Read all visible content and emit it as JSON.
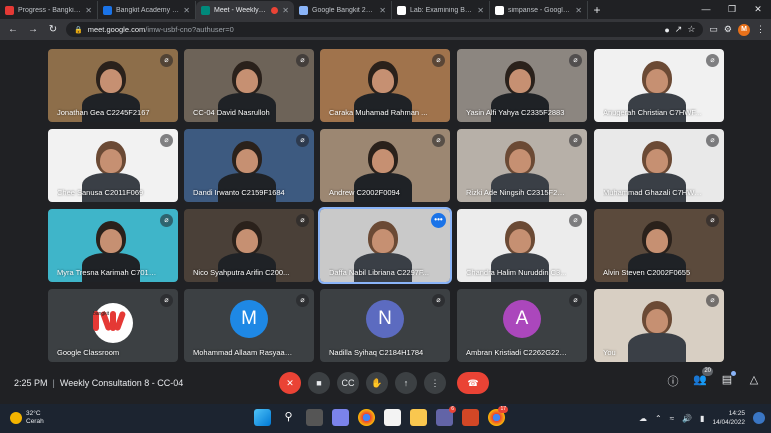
{
  "browser": {
    "tabs": [
      {
        "title": "Progress - Bangkit Stu",
        "favicon_color": "#e53935",
        "active": false
      },
      {
        "title": "Bangkit Academy - Cu",
        "favicon_color": "#1a73e8",
        "active": false
      },
      {
        "title": "Meet - Weekly Co",
        "favicon_color": "#00897b",
        "active": true,
        "recording": true
      },
      {
        "title": "Google Bangkit 2022",
        "favicon_color": "#8ab4f8",
        "active": false
      },
      {
        "title": "Lab: Examining Billing",
        "favicon_color": "#ffffff",
        "active": false
      },
      {
        "title": "simpanse - Google Se",
        "favicon_color": "#ffffff",
        "active": false
      }
    ],
    "new_tab": "+",
    "window_controls": [
      "—",
      "❒",
      "✕"
    ],
    "url_host": "meet.google.com",
    "url_rest": "/imw-usbf-cno?authuser=0",
    "profile_initial": "M"
  },
  "meet": {
    "participants": [
      {
        "name": "Jonathan Gea C2245F2167",
        "bg": "#8d6e4a",
        "type": "video",
        "muted": true
      },
      {
        "name": "CC-04 David Nasrulloh",
        "bg": "#6d6358",
        "type": "video",
        "muted": true
      },
      {
        "name": "Caraka Muhamad Rahman ...",
        "bg": "#a0734c",
        "type": "video",
        "muted": true
      },
      {
        "name": "Yasin Alfi Yahya C2335F2883",
        "bg": "#8c8680",
        "type": "video",
        "muted": true
      },
      {
        "name": "Anugerah Christian C7HWF...",
        "bg": "#f1f1f1",
        "type": "video",
        "muted": true
      },
      {
        "name": "Chee Sanusa C2011F069",
        "bg": "#f2f2f2",
        "type": "video",
        "muted": true
      },
      {
        "name": "Dandi Irwanto C2159F1684",
        "bg": "#3d5a80",
        "type": "video",
        "muted": true
      },
      {
        "name": "Andrew C2002F0094",
        "bg": "#9c8772",
        "type": "video",
        "muted": true
      },
      {
        "name": "Rizki Ade Ningsih C2315F2745",
        "bg": "#b7b0a8",
        "type": "video",
        "muted": true
      },
      {
        "name": "Muhammad Ghazali C7HWF...",
        "bg": "#e9e9e9",
        "type": "video",
        "muted": true
      },
      {
        "name": "Myra Tresna Karimah C7012...",
        "bg": "#3fb5c9",
        "type": "video",
        "muted": true
      },
      {
        "name": "Nico Syahputra Arifin C200...",
        "bg": "#4a4038",
        "type": "video",
        "muted": true
      },
      {
        "name": "Daffa Nabil Libriana C2297F...",
        "bg": "#c9c9c9",
        "type": "video",
        "muted": false,
        "speaking": true
      },
      {
        "name": "Chandra Halim Nuruddin C3...",
        "bg": "#ececec",
        "type": "video",
        "muted": true
      },
      {
        "name": "Alvin Steven C2002F0655",
        "bg": "#5b4a3c",
        "type": "video",
        "muted": true
      },
      {
        "name": "Google Classroom",
        "bg": "#3c4043",
        "type": "logo",
        "muted": true,
        "logo_text": "bangkit"
      },
      {
        "name": "Mohammad Allaam Rasyaad ...",
        "bg": "#3c4043",
        "type": "avatar",
        "initial": "M",
        "avatar_color": "#1e88e5",
        "muted": true
      },
      {
        "name": "Nadilla Syihaq C2184H1784",
        "bg": "#3c4043",
        "type": "avatar",
        "initial": "N",
        "avatar_color": "#5c6bc0",
        "muted": true
      },
      {
        "name": "Ambran Kristiadi C2262G2268",
        "bg": "#3c4043",
        "type": "avatar",
        "initial": "A",
        "avatar_color": "#ab47bc",
        "muted": true
      },
      {
        "name": "You",
        "bg": "#d8cfc3",
        "type": "video",
        "muted": true
      }
    ],
    "time": "2:25 PM",
    "separator": "|",
    "meeting_title": "Weekly Consultation 8 - CC-04",
    "controls": [
      {
        "icon": "mic-off-icon",
        "glyph": "✕",
        "style": "red"
      },
      {
        "icon": "camera-icon",
        "glyph": "■",
        "style": ""
      },
      {
        "icon": "captions-icon",
        "glyph": "CC",
        "style": ""
      },
      {
        "icon": "raise-hand-icon",
        "glyph": "✋",
        "style": ""
      },
      {
        "icon": "present-icon",
        "glyph": "↑",
        "style": ""
      },
      {
        "icon": "more-options-icon",
        "glyph": "⋮",
        "style": ""
      },
      {
        "icon": "end-call-icon",
        "glyph": "☎",
        "style": "end"
      }
    ],
    "participant_count": "20",
    "more_label": "•••"
  },
  "taskbar": {
    "temperature": "32°C",
    "weather": "Cerah",
    "time": "14:25",
    "date": "14/04/2022",
    "teams_badge": "6",
    "chrome_badge": "17"
  }
}
